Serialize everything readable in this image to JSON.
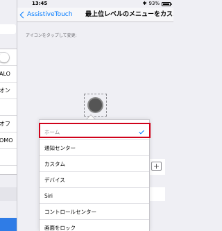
{
  "status_bar": {
    "time": "13:45",
    "battery": "93%",
    "bluetooth": "bluetooth-icon"
  },
  "nav": {
    "back_label": "AssistiveTouch",
    "title": "最上位レベルのメニューをカス..."
  },
  "section_header": "アイコンをタップして変更:",
  "left_panel": {
    "rows": [
      "",
      "ALO",
      "オン",
      "",
      "オフ",
      "OMO",
      ""
    ]
  },
  "menu": {
    "items": [
      "ホーム",
      "通知センター",
      "カスタム",
      "デバイス",
      "Siri",
      "コントロールセンター",
      "画面をロック"
    ],
    "selected_index": 0
  },
  "colors": {
    "accent": "#007aff",
    "highlight": "#d0021b",
    "panel_blue": "#2f7ce6"
  }
}
